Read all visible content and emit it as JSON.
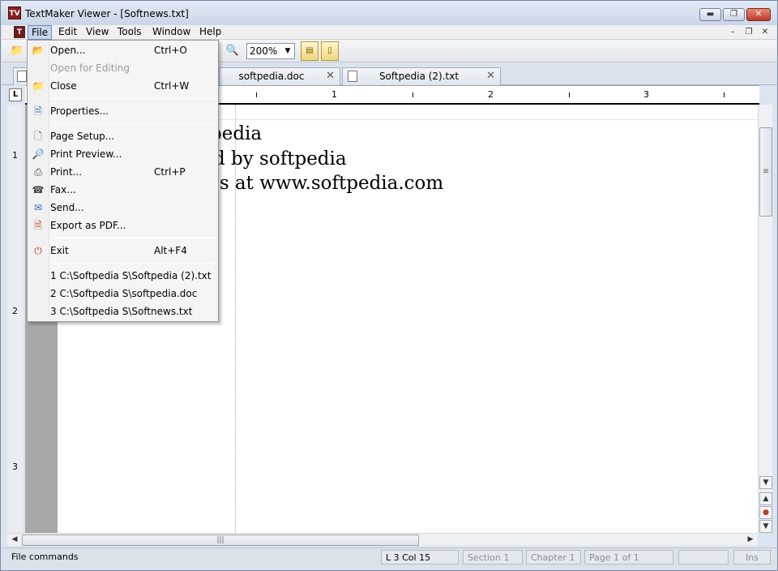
{
  "window": {
    "title": "TextMaker Viewer - [Softnews.txt]",
    "app_icon_text": "TV"
  },
  "menubar": {
    "doc_icon_text": "T",
    "items": [
      "File",
      "Edit",
      "View",
      "Tools",
      "Window",
      "Help"
    ]
  },
  "toolbar": {
    "zoom": "200%"
  },
  "tabs": [
    {
      "label": "softpedia.doc"
    },
    {
      "label": "Softpedia (2).txt"
    }
  ],
  "ruler": {
    "corner": "L",
    "h_numbers": [
      "1",
      "2",
      "3"
    ],
    "v_numbers": [
      "1",
      "2",
      "3"
    ]
  },
  "document": {
    "lines": [
      "pedia",
      "d by softpedia",
      " us at www.softpedia.com"
    ]
  },
  "file_menu": {
    "items": [
      {
        "label": "Open...",
        "shortcut": "Ctrl+O",
        "icon": "folder-open-icon",
        "enabled": true
      },
      {
        "label": "Open for Editing",
        "shortcut": "",
        "icon": "",
        "enabled": false
      },
      {
        "label": "Close",
        "shortcut": "Ctrl+W",
        "icon": "folder-close-icon",
        "enabled": true
      },
      {
        "label": "Properties...",
        "shortcut": "",
        "icon": "properties-icon",
        "enabled": true
      },
      {
        "label": "Page Setup...",
        "shortcut": "",
        "icon": "page-setup-icon",
        "enabled": true
      },
      {
        "label": "Print Preview...",
        "shortcut": "",
        "icon": "print-preview-icon",
        "enabled": true
      },
      {
        "label": "Print...",
        "shortcut": "Ctrl+P",
        "icon": "printer-icon",
        "enabled": true
      },
      {
        "label": "Fax...",
        "shortcut": "",
        "icon": "fax-icon",
        "enabled": true
      },
      {
        "label": "Send...",
        "shortcut": "",
        "icon": "mail-icon",
        "enabled": true
      },
      {
        "label": "Export as PDF...",
        "shortcut": "",
        "icon": "pdf-icon",
        "enabled": true
      },
      {
        "label": "Exit",
        "shortcut": "Alt+F4",
        "icon": "exit-icon",
        "enabled": true
      },
      {
        "label": "1 C:\\Softpedia S\\Softpedia (2).txt",
        "shortcut": "",
        "icon": "",
        "enabled": true
      },
      {
        "label": "2 C:\\Softpedia S\\softpedia.doc",
        "shortcut": "",
        "icon": "",
        "enabled": true
      },
      {
        "label": "3 C:\\Softpedia S\\Softnews.txt",
        "shortcut": "",
        "icon": "",
        "enabled": true
      }
    ]
  },
  "statusbar": {
    "message": "File commands",
    "position": "L 3 Col 15",
    "section": "Section 1",
    "chapter": "Chapter 1",
    "page": "Page 1 of 1",
    "mode": "Ins"
  },
  "colors": {
    "accent": "#6e8cb8",
    "close_red": "#c0392b"
  }
}
